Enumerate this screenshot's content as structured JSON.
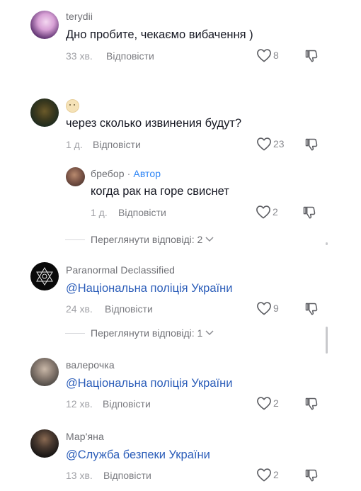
{
  "comments": [
    {
      "username": "terydii",
      "text": "Дно пробите, чекаємо вибачення )",
      "time": "33 хв.",
      "reply": "Відповісти",
      "likes": "8"
    },
    {
      "username_icon": "emoji-face-icon",
      "text": "через сколько извинения будут?",
      "time": "1 д.",
      "reply": "Відповісти",
      "likes": "23"
    },
    {
      "username": "бребор",
      "author_tag": "Автор",
      "separator": "·",
      "text": "когда рак на горе свиснет",
      "time": "1 д.",
      "reply": "Відповісти",
      "likes": "2"
    },
    {
      "username": "Paranormal Declassified",
      "text": "@Національна поліція України",
      "time": "24 хв.",
      "reply": "Відповісти",
      "likes": "9"
    },
    {
      "username": "валерочка",
      "text": "@Національна поліція України",
      "time": "12 хв.",
      "reply": "Відповісти",
      "likes": "2"
    },
    {
      "username": "Мар'яна",
      "text": "@Служба безпеки України",
      "time": "13 хв.",
      "reply": "Відповісти",
      "likes": "2"
    }
  ],
  "view_replies": [
    {
      "label": "Переглянути відповіді: 2"
    },
    {
      "label": "Переглянути відповіді: 1"
    }
  ]
}
